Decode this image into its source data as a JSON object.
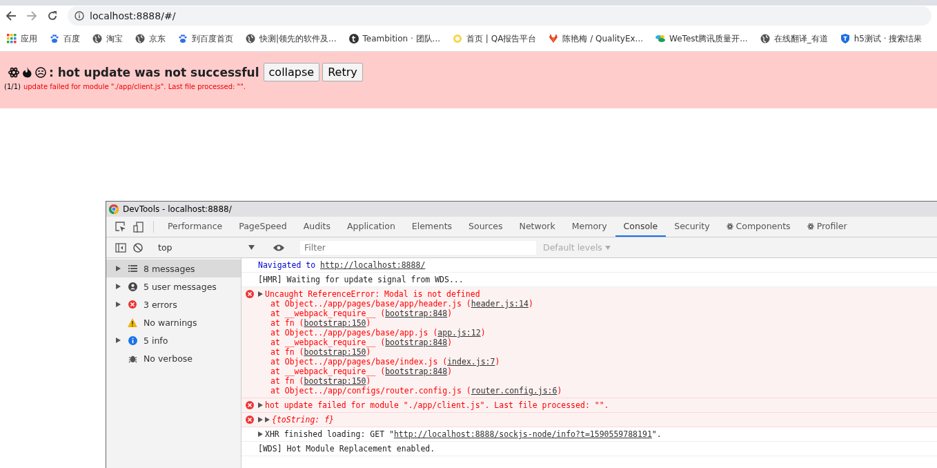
{
  "browser": {
    "url": "localhost:8888/#/",
    "bookmarks": [
      {
        "label": "应用",
        "kind": "apps"
      },
      {
        "label": "百度",
        "kind": "paw"
      },
      {
        "label": "淘宝",
        "kind": "globe"
      },
      {
        "label": "京东",
        "kind": "globe"
      },
      {
        "label": "到百度首页",
        "kind": "paw"
      },
      {
        "label": "快测|领先的软件及...",
        "kind": "globe"
      },
      {
        "label": "Teambition · 团队...",
        "kind": "letter"
      },
      {
        "label": "首页 | QA报告平台",
        "kind": "sun"
      },
      {
        "label": "陈艳梅 / QualityEx...",
        "kind": "fox"
      },
      {
        "label": "WeTest腾讯质量开...",
        "kind": "leaf"
      },
      {
        "label": "在线翻译_有道",
        "kind": "globe"
      },
      {
        "label": "h5测试 · 搜索结果",
        "kind": "shield"
      }
    ]
  },
  "overlay": {
    "title": ": hot update was not successful",
    "buttons": [
      "collapse",
      "Retry"
    ],
    "counter": "(1/1)",
    "message": "update failed for module \"./app/client.js\". Last file processed: \"\"."
  },
  "devtools": {
    "title": "DevTools - localhost:8888/",
    "tabs": [
      {
        "label": "Performance",
        "selected": false
      },
      {
        "label": "PageSpeed",
        "selected": false
      },
      {
        "label": "Audits",
        "selected": false
      },
      {
        "label": "Application",
        "selected": false
      },
      {
        "label": "Elements",
        "selected": false
      },
      {
        "label": "Sources",
        "selected": false
      },
      {
        "label": "Network",
        "selected": false
      },
      {
        "label": "Memory",
        "selected": false
      },
      {
        "label": "Console",
        "selected": true
      },
      {
        "label": "Security",
        "selected": false
      },
      {
        "label": "Components",
        "selected": false,
        "react": true
      },
      {
        "label": "Profiler",
        "selected": false,
        "react": true
      }
    ],
    "context": "top",
    "filter_placeholder": "Filter",
    "levels": "Default levels",
    "sidebar": [
      {
        "label": "8 messages",
        "kind": "list",
        "expandable": true,
        "selected": true
      },
      {
        "label": "5 user messages",
        "kind": "user",
        "expandable": true,
        "selected": false
      },
      {
        "label": "3 errors",
        "kind": "error",
        "expandable": true,
        "selected": false
      },
      {
        "label": "No warnings",
        "kind": "warning",
        "expandable": false,
        "selected": false
      },
      {
        "label": "5 info",
        "kind": "info",
        "expandable": true,
        "selected": false
      },
      {
        "label": "No verbose",
        "kind": "verbose",
        "expandable": false,
        "selected": false
      }
    ],
    "messages": [
      {
        "kind": "nav",
        "expandable": false,
        "text": "Navigated to",
        "link": "http://localhost:8888/"
      },
      {
        "kind": "log",
        "expandable": false,
        "text": "[HMR] Waiting for update signal from WDS..."
      },
      {
        "kind": "error",
        "expandable": true,
        "text": "Uncaught ReferenceError: Modal is not defined",
        "frames": [
          {
            "text": "at Object../app/pages/base/app/header.js (",
            "link": "header.js:14",
            "after": ")"
          },
          {
            "text": "at __webpack_require__ (",
            "link": "bootstrap:848",
            "after": ")"
          },
          {
            "text": "at fn (",
            "link": "bootstrap:150",
            "after": ")"
          },
          {
            "text": "at Object../app/pages/base/app.js (",
            "link": "app.js:12",
            "after": ")"
          },
          {
            "text": "at __webpack_require__ (",
            "link": "bootstrap:848",
            "after": ")"
          },
          {
            "text": "at fn (",
            "link": "bootstrap:150",
            "after": ")"
          },
          {
            "text": "at Object../app/pages/base/index.js (",
            "link": "index.js:7",
            "after": ")"
          },
          {
            "text": "at __webpack_require__ (",
            "link": "bootstrap:848",
            "after": ")"
          },
          {
            "text": "at fn (",
            "link": "bootstrap:150",
            "after": ")"
          },
          {
            "text": "at Object../app/configs/router.config.js (",
            "link": "router.config.js:6",
            "after": ")"
          }
        ]
      },
      {
        "kind": "error",
        "expandable": true,
        "text": "hot update failed for module \"./app/client.js\". Last file processed: \"\"."
      },
      {
        "kind": "object",
        "expandable": true,
        "text": "{toString: f}",
        "italic": true
      },
      {
        "kind": "log",
        "expandable": true,
        "text": "XHR finished loading: GET \"",
        "link": "http://localhost:8888/sockjs-node/info?t=1590559788191",
        "after": "\"."
      },
      {
        "kind": "log",
        "expandable": false,
        "text": "[WDS] Hot Module Replacement enabled."
      }
    ]
  }
}
